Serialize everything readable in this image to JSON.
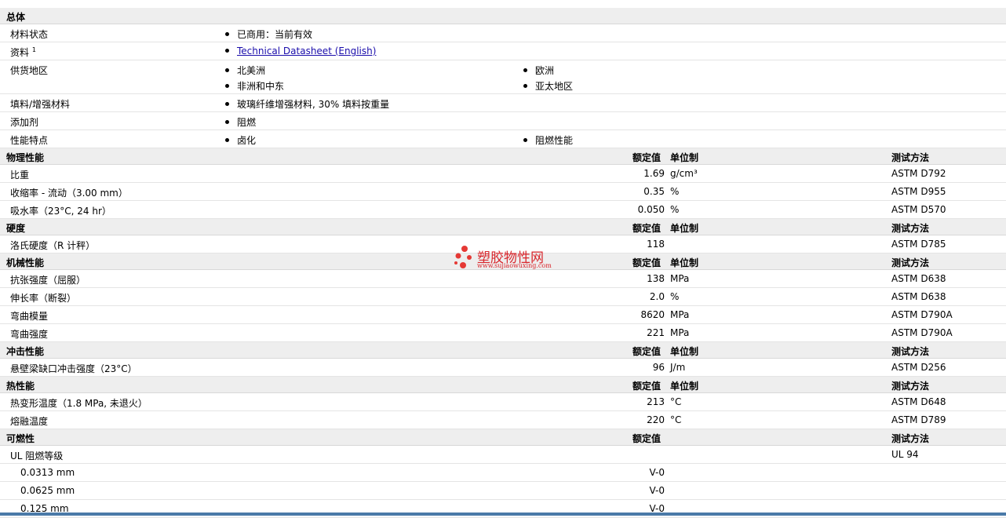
{
  "general": {
    "title": "总体",
    "rows": {
      "status": {
        "label": "材料状态",
        "value": "已商用：当前有效"
      },
      "docs": {
        "label": "资料",
        "sup": "1",
        "link": "Technical Datasheet (English)"
      },
      "region": {
        "label": "供货地区",
        "v1": "北美洲",
        "v2": "欧洲",
        "v3": "非洲和中东",
        "v4": "亚太地区"
      },
      "filler": {
        "label": "填料/增强材料",
        "value": "玻璃纤维增强材料, 30% 填料按重量"
      },
      "additive": {
        "label": "添加剂",
        "value": "阻燃"
      },
      "features": {
        "label": "性能特点",
        "v1": "卤化",
        "v2": "阻燃性能"
      }
    }
  },
  "columns": {
    "nominal": "额定值",
    "unit": "单位制",
    "method": "测试方法"
  },
  "physical": {
    "title": "物理性能",
    "rows": [
      {
        "label": "比重",
        "value": "1.69",
        "unit": "g/cm³",
        "method": "ASTM D792"
      },
      {
        "label": "收缩率  - 流动（3.00 mm）",
        "value": "0.35",
        "unit": "%",
        "method": "ASTM D955"
      },
      {
        "label": "吸水率（23°C, 24 hr）",
        "value": "0.050",
        "unit": "%",
        "method": "ASTM D570"
      }
    ]
  },
  "hardness": {
    "title": "硬度",
    "rows": [
      {
        "label": "洛氏硬度（R 计秤）",
        "value": "118",
        "unit": "",
        "method": "ASTM D785"
      }
    ]
  },
  "mechanical": {
    "title": "机械性能",
    "rows": [
      {
        "label": "抗张强度（屈服）",
        "value": "138",
        "unit": "MPa",
        "method": "ASTM D638"
      },
      {
        "label": "伸长率（断裂）",
        "value": "2.0",
        "unit": "%",
        "method": "ASTM D638"
      },
      {
        "label": "弯曲模量",
        "value": "8620",
        "unit": "MPa",
        "method": "ASTM D790A"
      },
      {
        "label": "弯曲强度",
        "value": "221",
        "unit": "MPa",
        "method": "ASTM D790A"
      }
    ]
  },
  "impact": {
    "title": "冲击性能",
    "rows": [
      {
        "label": "悬壁梁缺口冲击强度（23°C）",
        "value": "96",
        "unit": "J/m",
        "method": "ASTM D256"
      }
    ]
  },
  "thermal": {
    "title": "热性能",
    "rows": [
      {
        "label": "热变形温度（1.8 MPa, 未退火）",
        "value": "213",
        "unit": "°C",
        "method": "ASTM D648"
      },
      {
        "label": "熔融温度",
        "value": "220",
        "unit": "°C",
        "method": "ASTM D789"
      }
    ]
  },
  "flammability": {
    "title": "可燃性",
    "ul": {
      "label": "UL 阻燃等级",
      "method": "UL 94"
    },
    "rows": [
      {
        "label": "0.0313 mm",
        "value": "V-0"
      },
      {
        "label": "0.0625 mm",
        "value": "V-0"
      },
      {
        "label": "0.125 mm",
        "value": "V-0"
      }
    ]
  },
  "watermark": {
    "brand": "塑胶物性网",
    "url": "www.sujiaowuxing.com"
  },
  "colors": {
    "header_bg": "#eeeeee",
    "link": "#1a0dab",
    "watermark": "#d9262c"
  }
}
